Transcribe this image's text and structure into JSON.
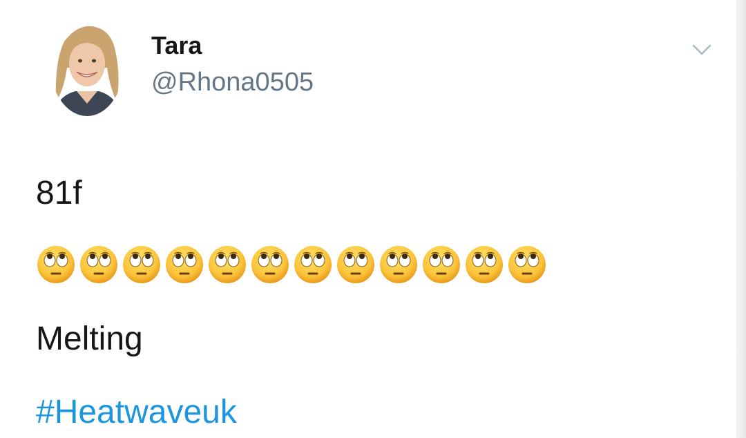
{
  "tweet": {
    "author": {
      "name": "Tara",
      "handle": "@Rhona0505"
    },
    "lines": [
      "81f",
      "Melting"
    ],
    "hashtag": "#Heatwaveuk",
    "emoji": {
      "icon": "face-with-rolling-eyes-icon",
      "count": 12
    }
  },
  "colors": {
    "name": "#14171a",
    "handle": "#657786",
    "hashtag": "#1b95e0",
    "chevron": "#aab8c2"
  }
}
